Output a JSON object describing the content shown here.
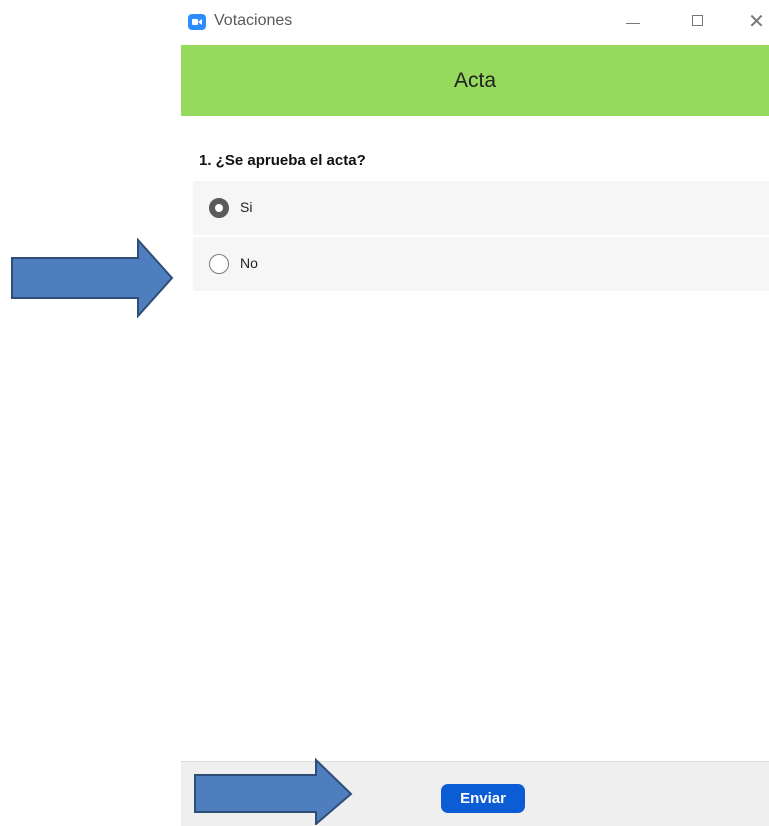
{
  "window": {
    "title": "Votaciones",
    "minimize_icon": "minimize-icon",
    "maximize_icon": "maximize-icon",
    "close_icon": "close-icon",
    "close_glyph": "✕"
  },
  "header": {
    "title": "Acta"
  },
  "poll": {
    "question": "1. ¿Se aprueba el acta?",
    "options": [
      {
        "label": "Si",
        "selected": true
      },
      {
        "label": "No",
        "selected": false
      }
    ]
  },
  "footer": {
    "send_label": "Enviar"
  },
  "colors": {
    "header_bg": "#95d95d",
    "send_button": "#0b5cd5",
    "arrow_fill": "#4e7ebd",
    "arrow_stroke": "#2e4e78"
  }
}
